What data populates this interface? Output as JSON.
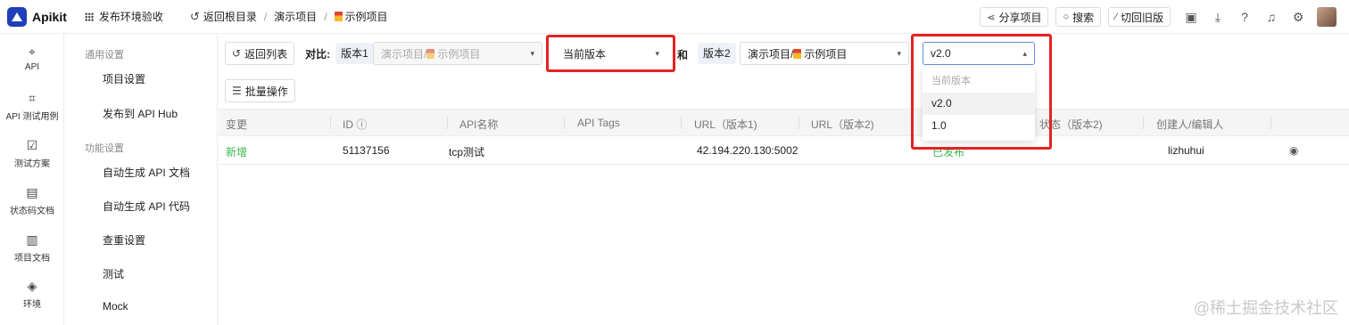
{
  "app": {
    "name": "Apikit"
  },
  "header": {
    "env_label": "发布环境验收",
    "back_root": "返回根目录",
    "crumbs": [
      "演示项目",
      "示例项目"
    ],
    "share": "分享项目",
    "search": "搜索",
    "switch_old": "切回旧版"
  },
  "rail": [
    {
      "label": "API",
      "icon": "api-icon"
    },
    {
      "label": "API 测试用例",
      "icon": "test-case-icon"
    },
    {
      "label": "测试方案",
      "icon": "test-plan-icon"
    },
    {
      "label": "状态码文档",
      "icon": "status-doc-icon"
    },
    {
      "label": "项目文档",
      "icon": "project-doc-icon"
    },
    {
      "label": "环境",
      "icon": "environment-icon"
    }
  ],
  "menu": {
    "group1": "通用设置",
    "item1": "项目设置",
    "item2": "发布到 API Hub",
    "group2": "功能设置",
    "item3": "自动生成 API 文档",
    "item4": "自动生成 API 代码",
    "item5": "查重设置",
    "item6": "测试",
    "item7": "Mock"
  },
  "compare": {
    "back_list": "返回列表",
    "label": "对比:",
    "v1_tag": "版本1",
    "v1_project": "演示项目/",
    "v1_project_name": "示例项目",
    "v1_version": "当前版本",
    "and": "和",
    "v2_tag": "版本2",
    "v2_project": "演示项目/",
    "v2_project_name": "示例项目",
    "v2_version": "v2.0"
  },
  "batch": "批量操作",
  "table": {
    "headers": [
      "变更",
      "ID",
      "API名称",
      "API Tags",
      "URL（版本1)",
      "URL（版本2)",
      "状态（版本2)",
      "创建人/编辑人"
    ],
    "rows": [
      {
        "change": "新增",
        "id": "51137156",
        "name": "tcp测试",
        "tags": "",
        "url1": "42.194.220.130:5002",
        "url2": "",
        "status": "已发布",
        "creator": "lizhuhui"
      }
    ]
  },
  "dropdown": {
    "options": [
      "当前版本",
      "v2.0",
      "1.0"
    ],
    "selected": "v2.0"
  },
  "watermark": "@稀土掘金技术社区",
  "colors": {
    "brand": "#1f3fb8",
    "highlight": "#e32222",
    "added": "#3bb64e"
  }
}
